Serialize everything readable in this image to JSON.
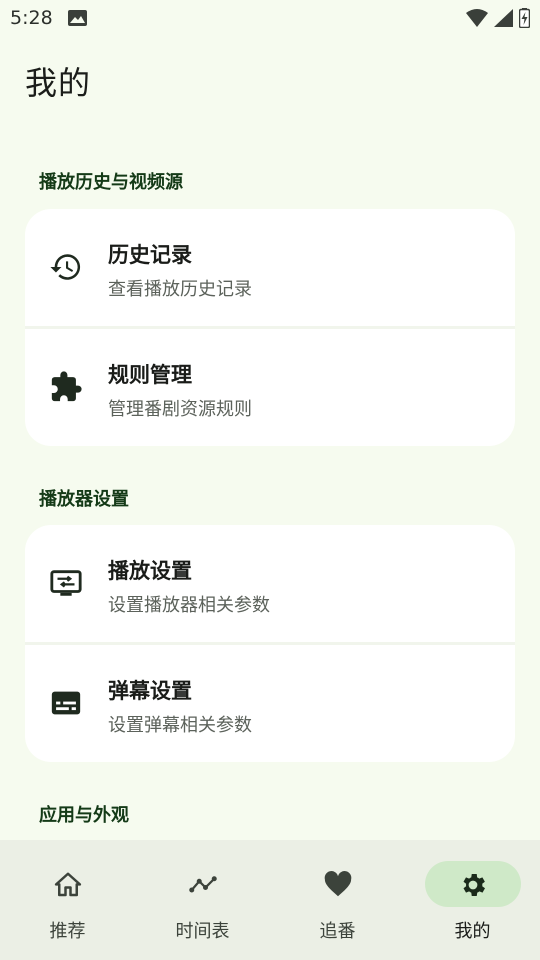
{
  "status_bar": {
    "time": "5:28"
  },
  "page": {
    "title": "我的"
  },
  "sections": [
    {
      "title": "播放历史与视频源",
      "items": [
        {
          "title": "历史记录",
          "subtitle": "查看播放历史记录",
          "icon": "history-icon"
        },
        {
          "title": "规则管理",
          "subtitle": "管理番剧资源规则",
          "icon": "puzzle-icon"
        }
      ]
    },
    {
      "title": "播放器设置",
      "items": [
        {
          "title": "播放设置",
          "subtitle": "设置播放器相关参数",
          "icon": "player-settings-icon"
        },
        {
          "title": "弹幕设置",
          "subtitle": "设置弹幕相关参数",
          "icon": "subtitles-icon"
        }
      ]
    },
    {
      "title": "应用与外观"
    }
  ],
  "bottom_nav": {
    "items": [
      {
        "label": "推荐",
        "icon": "home-icon"
      },
      {
        "label": "时间表",
        "icon": "timeline-icon"
      },
      {
        "label": "追番",
        "icon": "heart-icon"
      },
      {
        "label": "我的",
        "icon": "gear-icon",
        "active": true
      }
    ]
  },
  "colors": {
    "background": "#f6fbef",
    "section_title": "#143a17",
    "nav_background": "#ebefe5",
    "nav_active_pill": "#cfe9c8"
  }
}
